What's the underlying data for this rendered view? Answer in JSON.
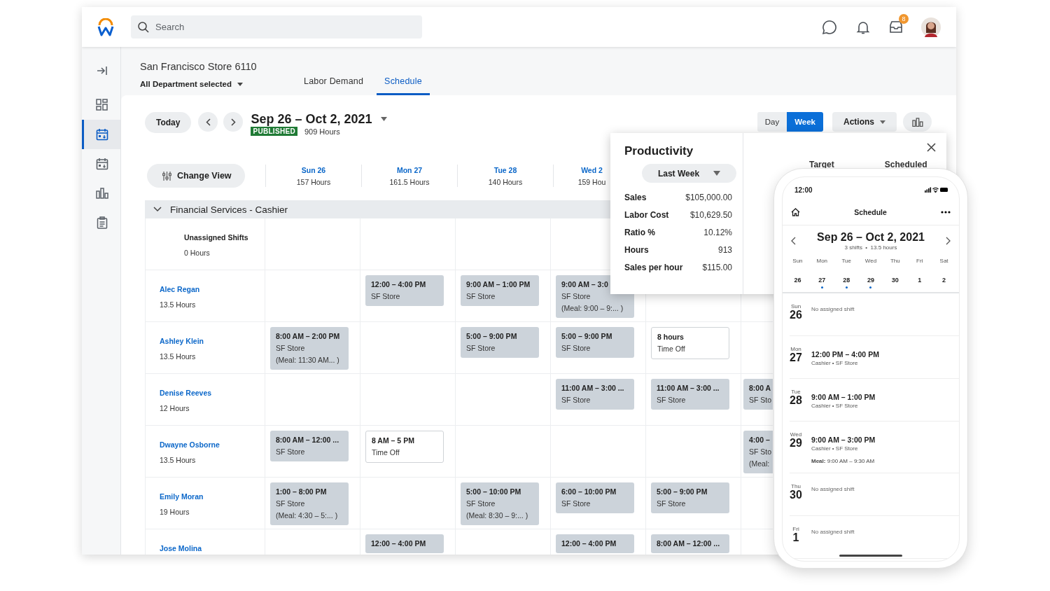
{
  "app_bar": {
    "search": {
      "placeholder": "Search"
    },
    "inbox_badge": "8"
  },
  "rail": [
    {
      "kind": "expand",
      "selected": false
    },
    {
      "kind": "dashboard",
      "selected": false
    },
    {
      "kind": "schedule",
      "selected": true
    },
    {
      "kind": "calendar",
      "selected": false
    },
    {
      "kind": "chart",
      "selected": false
    },
    {
      "kind": "clipboard",
      "selected": false
    }
  ],
  "header": {
    "store": "San Francisco Store 6110",
    "department": "All Department selected"
  },
  "tabs": [
    {
      "label": "Labor Demand",
      "selected": false
    },
    {
      "label": "Schedule",
      "selected": true
    }
  ],
  "toolbar": {
    "today": "Today",
    "date_range": "Sep 26 – Oct 2, 2021",
    "status": "PUBLISHED",
    "total_hours": "909 Hours",
    "views": [
      {
        "label": "Day",
        "selected": false
      },
      {
        "label": "Week",
        "selected": true
      }
    ],
    "actions": "Actions"
  },
  "change_view": "Change View",
  "days": [
    {
      "label": "Sun 26",
      "hours": "157 Hours"
    },
    {
      "label": "Mon 27",
      "hours": "161.5 Hours"
    },
    {
      "label": "Tue 28",
      "hours": "140 Hours"
    },
    {
      "label": "Wed 2",
      "hours": "159 Hou"
    }
  ],
  "group": {
    "title": "Financial Services - Cashier",
    "expanded": true
  },
  "rows": [
    {
      "kind": "unassigned",
      "name": "Unassigned Shifts",
      "hours": "0 Hours",
      "cells": [
        {
          "kind": "empty"
        },
        {
          "kind": "empty"
        },
        {
          "kind": "empty"
        },
        {
          "kind": "empty"
        },
        {
          "kind": "empty"
        },
        {
          "kind": "empty"
        }
      ]
    },
    {
      "kind": "employee",
      "name": "Alec Regan",
      "hours": "13.5 Hours",
      "cells": [
        {
          "kind": "empty"
        },
        {
          "kind": "shift",
          "lines": [
            "12:00 – 4:00 PM",
            "SF Store"
          ]
        },
        {
          "kind": "shift",
          "lines": [
            "9:00 AM – 1:00 PM",
            "SF Store"
          ]
        },
        {
          "kind": "shift",
          "lines": [
            "9:00 AM – 3:0",
            "SF Store",
            "(Meal: 9:00 – 9:... )"
          ]
        },
        {
          "kind": "empty"
        },
        {
          "kind": "empty"
        }
      ]
    },
    {
      "kind": "employee",
      "name": "Ashley Klein",
      "hours": "13.5 Hours",
      "cells": [
        {
          "kind": "shift",
          "lines": [
            "8:00 AM – 2:00 PM",
            "SF Store",
            "(Meal: 11:30 AM... )"
          ]
        },
        {
          "kind": "empty"
        },
        {
          "kind": "shift",
          "lines": [
            "5:00 – 9:00 PM",
            "SF Store"
          ]
        },
        {
          "kind": "shift",
          "lines": [
            "5:00 – 9:00 PM",
            "SF Store"
          ]
        },
        {
          "kind": "timeoff",
          "lines": [
            "8 hours",
            "Time Off"
          ]
        },
        {
          "kind": "empty"
        }
      ]
    },
    {
      "kind": "employee",
      "name": "Denise Reeves",
      "hours": "12 Hours",
      "cells": [
        {
          "kind": "empty"
        },
        {
          "kind": "empty"
        },
        {
          "kind": "empty"
        },
        {
          "kind": "shift",
          "lines": [
            "11:00 AM – 3:00 ...",
            "SF Store"
          ]
        },
        {
          "kind": "shift",
          "lines": [
            "11:00 AM – 3:00 ...",
            "SF Store"
          ]
        },
        {
          "kind": "shift",
          "lines": [
            "8:00 A",
            "SF Sto"
          ]
        }
      ]
    },
    {
      "kind": "employee",
      "name": "Dwayne Osborne",
      "hours": "13.5 Hours",
      "cells": [
        {
          "kind": "shift",
          "lines": [
            "8:00 AM – 12:00 ...",
            "SF Store"
          ]
        },
        {
          "kind": "timeoff",
          "lines": [
            "8 AM – 5 PM",
            "Time Off"
          ]
        },
        {
          "kind": "empty"
        },
        {
          "kind": "empty"
        },
        {
          "kind": "empty"
        },
        {
          "kind": "shift",
          "lines": [
            "4:00 –",
            "SF Sto",
            "(Meal:"
          ]
        }
      ]
    },
    {
      "kind": "employee",
      "name": "Emily Moran",
      "hours": "19 Hours",
      "cells": [
        {
          "kind": "shift",
          "lines": [
            "1:00 – 8:00 PM",
            "SF Store",
            "(Meal: 4:30 – 5:... )"
          ]
        },
        {
          "kind": "empty"
        },
        {
          "kind": "shift",
          "lines": [
            "5:00 – 10:00 PM",
            "SF Store",
            "(Meal: 8:30 – 9:... )"
          ]
        },
        {
          "kind": "shift",
          "lines": [
            "6:00 – 10:00 PM",
            "SF Store"
          ]
        },
        {
          "kind": "shift",
          "lines": [
            "5:00 – 9:00 PM",
            "SF Store"
          ]
        },
        {
          "kind": "empty"
        }
      ]
    },
    {
      "kind": "employee",
      "name": "Jose Molina",
      "cells": [
        {
          "kind": "empty"
        },
        {
          "kind": "shift",
          "lines": [
            "12:00 – 4:00 PM"
          ]
        },
        {
          "kind": "empty"
        },
        {
          "kind": "shift",
          "lines": [
            "12:00 – 4:00 PM"
          ]
        },
        {
          "kind": "shift",
          "lines": [
            "8:00 AM – 12:00 ..."
          ]
        },
        {
          "kind": "empty"
        }
      ]
    }
  ],
  "productivity": {
    "title": "Productivity",
    "period": "Last Week",
    "metrics": [
      {
        "label": "Sales",
        "value": "$105,000.00"
      },
      {
        "label": "Labor Cost",
        "value": "$10,629.50"
      },
      {
        "label": "Ratio %",
        "value": "10.12%"
      },
      {
        "label": "Hours",
        "value": "913"
      },
      {
        "label": "Sales per hour",
        "value": "$115.00"
      }
    ],
    "columns": [
      "Target",
      "Scheduled"
    ]
  },
  "phone": {
    "time": "12:00",
    "title": "Schedule",
    "range": "Sep 26 – Oct 2, 2021",
    "summary": "3 shifts  •  13.5 hours",
    "week": [
      {
        "day": "Sun",
        "date": "26",
        "has_shift": false
      },
      {
        "day": "Mon",
        "date": "27",
        "has_shift": true
      },
      {
        "day": "Tue",
        "date": "28",
        "has_shift": true
      },
      {
        "day": "Wed",
        "date": "29",
        "has_shift": true
      },
      {
        "day": "Thu",
        "date": "30",
        "has_shift": false
      },
      {
        "day": "Fri",
        "date": "1",
        "has_shift": false
      },
      {
        "day": "Sat",
        "date": "2",
        "has_shift": false
      }
    ],
    "agenda": [
      {
        "kind": "none",
        "day": "Sun",
        "date": "26",
        "text": "No assigned shift"
      },
      {
        "kind": "shift",
        "day": "Mon",
        "date": "27",
        "time": "12:00 PM – 4:00 PM",
        "detail": "Cashier • SF Store"
      },
      {
        "kind": "shift",
        "day": "Tue",
        "date": "28",
        "time": "9:00 AM – 1:00 PM",
        "detail": "Cashier • SF Store"
      },
      {
        "kind": "shift",
        "day": "Wed",
        "date": "29",
        "time": "9:00 AM – 3:00 PM",
        "detail": "Cashier • SF Store",
        "meal": "**Meal:** 9:00 AM – 9:30 AM"
      },
      {
        "kind": "none",
        "day": "Thu",
        "date": "30",
        "text": "No assigned shift"
      },
      {
        "kind": "none",
        "day": "Fri",
        "date": "1",
        "text": "No assigned shift"
      }
    ]
  }
}
